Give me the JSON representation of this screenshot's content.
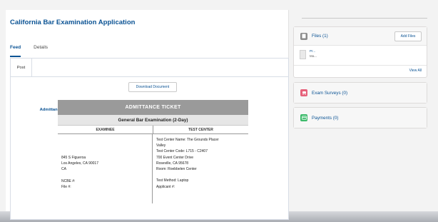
{
  "app": {
    "title": "California Bar Examination Application"
  },
  "tabs": {
    "feed": "Feed",
    "details": "Details"
  },
  "feed": {
    "post_tab": "Post",
    "ticket_tab": "Admittance Ticket",
    "download_label": "Download Document"
  },
  "ticket": {
    "heading": "ADMITTANCE TICKET",
    "exam_type": "General Bar Examination (2-Day)",
    "col_examinee": "EXAMINEE",
    "col_center": "TEST CENTER",
    "examinee": {
      "address1": "845 S Figueroa",
      "address2": "Los Angeles, CA  90017",
      "country": "CA",
      "ncbe": "NCBE #:",
      "file": "File #:"
    },
    "center": {
      "name1": "Test Center Name: The Grounds Placer",
      "name2": "Valley",
      "code": "Test Center Code: L715 - C2407",
      "street": "700 Event Center Drive",
      "city": "Roseville, CA  95678",
      "room": "Room: Roebbelen Center",
      "method": "Test Method: Laptop",
      "applicant": "Applicant #:"
    }
  },
  "sidebar": {
    "files_title": "Files (1)",
    "add_files": "Add Files",
    "file_name": "Pr...",
    "file_sub": "Ma...",
    "view_all": "View All",
    "surveys_title": "Exam Surveys (0)",
    "payments_title": "Payments (0)"
  },
  "colors": {
    "brand": "#0b5394",
    "surveys_icon": "#e6617a",
    "payments_icon": "#3cba6a",
    "files_icon": "#8b8b8b"
  }
}
